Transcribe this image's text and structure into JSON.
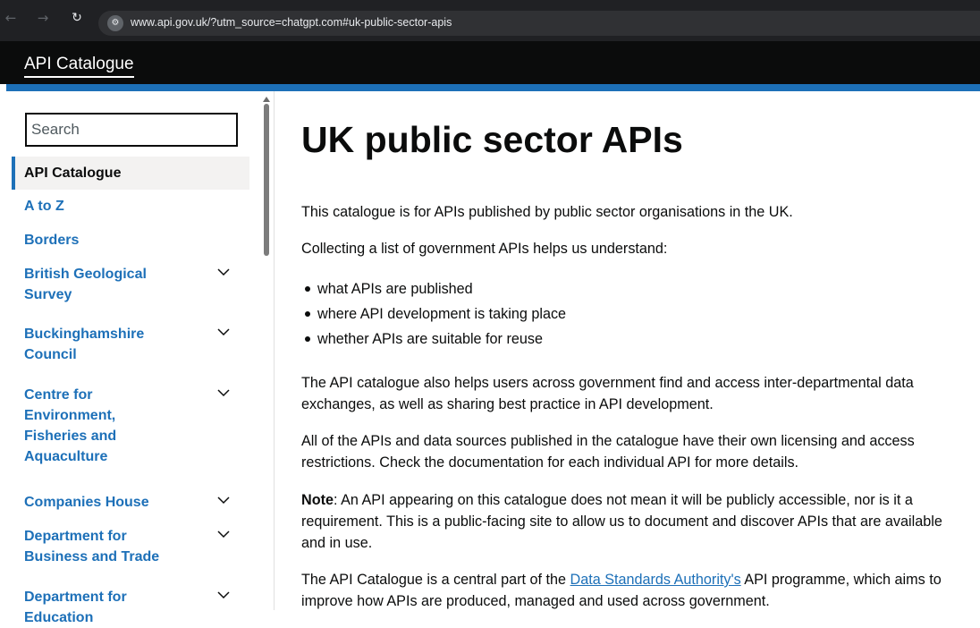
{
  "browser": {
    "url": "www.api.gov.uk/?utm_source=chatgpt.com#uk-public-sector-apis"
  },
  "header": {
    "title": "API Catalogue"
  },
  "search": {
    "placeholder": "Search"
  },
  "sidebar": {
    "items": [
      {
        "label": "API Catalogue",
        "active": true,
        "expandable": false
      },
      {
        "label": "A to Z",
        "active": false,
        "expandable": false
      },
      {
        "label": "Borders",
        "active": false,
        "expandable": false
      },
      {
        "label": "British Geological Survey",
        "active": false,
        "expandable": true
      },
      {
        "label": "Buckinghamshire Council",
        "active": false,
        "expandable": true
      },
      {
        "label": "Centre for Environment, Fisheries and Aquaculture",
        "active": false,
        "expandable": true
      },
      {
        "label": "Companies House",
        "active": false,
        "expandable": true
      },
      {
        "label": "Department for Business and Trade",
        "active": false,
        "expandable": true
      },
      {
        "label": "Department for Education",
        "active": false,
        "expandable": true
      }
    ]
  },
  "main": {
    "title": "UK public sector APIs",
    "intro": "This catalogue is for APIs published by public sector organisations in the UK.",
    "lead": "Collecting a list of government APIs helps us understand:",
    "bullets": [
      "what APIs are published",
      "where API development is taking place",
      "whether APIs are suitable for reuse"
    ],
    "para_help": "The API catalogue also helps users across government find and access inter-departmental data exchanges, as well as sharing best practice in API development.",
    "para_licensing": "All of the APIs and data sources published in the catalogue have their own licensing and access restrictions. Check the documentation for each individual API for more details.",
    "note_label": "Note",
    "note_text": ": An API appearing on this catalogue does not mean it will be publicly accessible, nor is it a requirement. This is a public-facing site to allow us to document and discover APIs that are available and in use.",
    "final_before": "The API Catalogue is a central part of the ",
    "final_link": "Data Standards Authority's",
    "final_after": " API programme, which aims to improve how APIs are produced, managed and used across government."
  },
  "colors": {
    "link": "#1d70b8",
    "header_bg": "#0b0c0c",
    "accent_bar": "#1d70b8",
    "active_bg": "#f3f2f1"
  }
}
